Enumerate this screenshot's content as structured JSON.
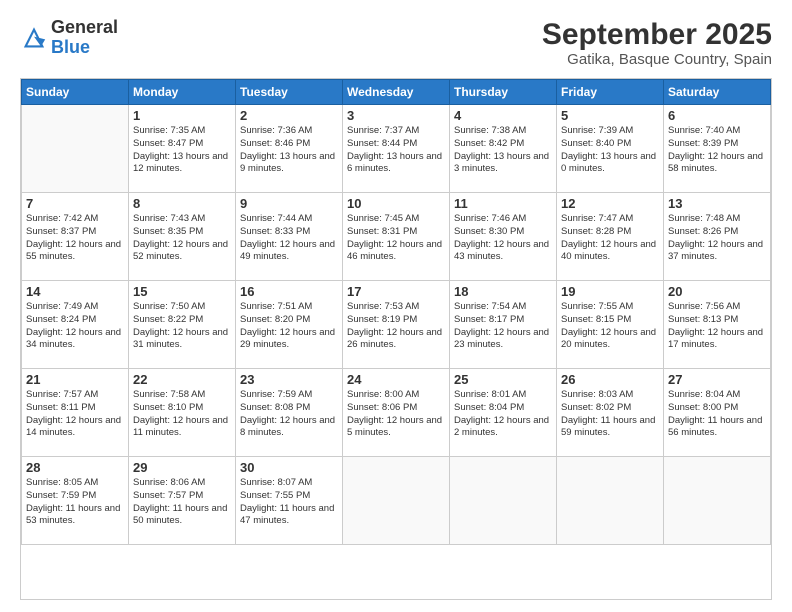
{
  "logo": {
    "general": "General",
    "blue": "Blue"
  },
  "title": "September 2025",
  "subtitle": "Gatika, Basque Country, Spain",
  "days_of_week": [
    "Sunday",
    "Monday",
    "Tuesday",
    "Wednesday",
    "Thursday",
    "Friday",
    "Saturday"
  ],
  "weeks": [
    [
      {
        "day": "",
        "info": ""
      },
      {
        "day": "1",
        "info": "Sunrise: 7:35 AM\nSunset: 8:47 PM\nDaylight: 13 hours\nand 12 minutes."
      },
      {
        "day": "2",
        "info": "Sunrise: 7:36 AM\nSunset: 8:46 PM\nDaylight: 13 hours\nand 9 minutes."
      },
      {
        "day": "3",
        "info": "Sunrise: 7:37 AM\nSunset: 8:44 PM\nDaylight: 13 hours\nand 6 minutes."
      },
      {
        "day": "4",
        "info": "Sunrise: 7:38 AM\nSunset: 8:42 PM\nDaylight: 13 hours\nand 3 minutes."
      },
      {
        "day": "5",
        "info": "Sunrise: 7:39 AM\nSunset: 8:40 PM\nDaylight: 13 hours\nand 0 minutes."
      },
      {
        "day": "6",
        "info": "Sunrise: 7:40 AM\nSunset: 8:39 PM\nDaylight: 12 hours\nand 58 minutes."
      }
    ],
    [
      {
        "day": "7",
        "info": "Sunrise: 7:42 AM\nSunset: 8:37 PM\nDaylight: 12 hours\nand 55 minutes."
      },
      {
        "day": "8",
        "info": "Sunrise: 7:43 AM\nSunset: 8:35 PM\nDaylight: 12 hours\nand 52 minutes."
      },
      {
        "day": "9",
        "info": "Sunrise: 7:44 AM\nSunset: 8:33 PM\nDaylight: 12 hours\nand 49 minutes."
      },
      {
        "day": "10",
        "info": "Sunrise: 7:45 AM\nSunset: 8:31 PM\nDaylight: 12 hours\nand 46 minutes."
      },
      {
        "day": "11",
        "info": "Sunrise: 7:46 AM\nSunset: 8:30 PM\nDaylight: 12 hours\nand 43 minutes."
      },
      {
        "day": "12",
        "info": "Sunrise: 7:47 AM\nSunset: 8:28 PM\nDaylight: 12 hours\nand 40 minutes."
      },
      {
        "day": "13",
        "info": "Sunrise: 7:48 AM\nSunset: 8:26 PM\nDaylight: 12 hours\nand 37 minutes."
      }
    ],
    [
      {
        "day": "14",
        "info": "Sunrise: 7:49 AM\nSunset: 8:24 PM\nDaylight: 12 hours\nand 34 minutes."
      },
      {
        "day": "15",
        "info": "Sunrise: 7:50 AM\nSunset: 8:22 PM\nDaylight: 12 hours\nand 31 minutes."
      },
      {
        "day": "16",
        "info": "Sunrise: 7:51 AM\nSunset: 8:20 PM\nDaylight: 12 hours\nand 29 minutes."
      },
      {
        "day": "17",
        "info": "Sunrise: 7:53 AM\nSunset: 8:19 PM\nDaylight: 12 hours\nand 26 minutes."
      },
      {
        "day": "18",
        "info": "Sunrise: 7:54 AM\nSunset: 8:17 PM\nDaylight: 12 hours\nand 23 minutes."
      },
      {
        "day": "19",
        "info": "Sunrise: 7:55 AM\nSunset: 8:15 PM\nDaylight: 12 hours\nand 20 minutes."
      },
      {
        "day": "20",
        "info": "Sunrise: 7:56 AM\nSunset: 8:13 PM\nDaylight: 12 hours\nand 17 minutes."
      }
    ],
    [
      {
        "day": "21",
        "info": "Sunrise: 7:57 AM\nSunset: 8:11 PM\nDaylight: 12 hours\nand 14 minutes."
      },
      {
        "day": "22",
        "info": "Sunrise: 7:58 AM\nSunset: 8:10 PM\nDaylight: 12 hours\nand 11 minutes."
      },
      {
        "day": "23",
        "info": "Sunrise: 7:59 AM\nSunset: 8:08 PM\nDaylight: 12 hours\nand 8 minutes."
      },
      {
        "day": "24",
        "info": "Sunrise: 8:00 AM\nSunset: 8:06 PM\nDaylight: 12 hours\nand 5 minutes."
      },
      {
        "day": "25",
        "info": "Sunrise: 8:01 AM\nSunset: 8:04 PM\nDaylight: 12 hours\nand 2 minutes."
      },
      {
        "day": "26",
        "info": "Sunrise: 8:03 AM\nSunset: 8:02 PM\nDaylight: 11 hours\nand 59 minutes."
      },
      {
        "day": "27",
        "info": "Sunrise: 8:04 AM\nSunset: 8:00 PM\nDaylight: 11 hours\nand 56 minutes."
      }
    ],
    [
      {
        "day": "28",
        "info": "Sunrise: 8:05 AM\nSunset: 7:59 PM\nDaylight: 11 hours\nand 53 minutes."
      },
      {
        "day": "29",
        "info": "Sunrise: 8:06 AM\nSunset: 7:57 PM\nDaylight: 11 hours\nand 50 minutes."
      },
      {
        "day": "30",
        "info": "Sunrise: 8:07 AM\nSunset: 7:55 PM\nDaylight: 11 hours\nand 47 minutes."
      },
      {
        "day": "",
        "info": ""
      },
      {
        "day": "",
        "info": ""
      },
      {
        "day": "",
        "info": ""
      },
      {
        "day": "",
        "info": ""
      }
    ]
  ]
}
